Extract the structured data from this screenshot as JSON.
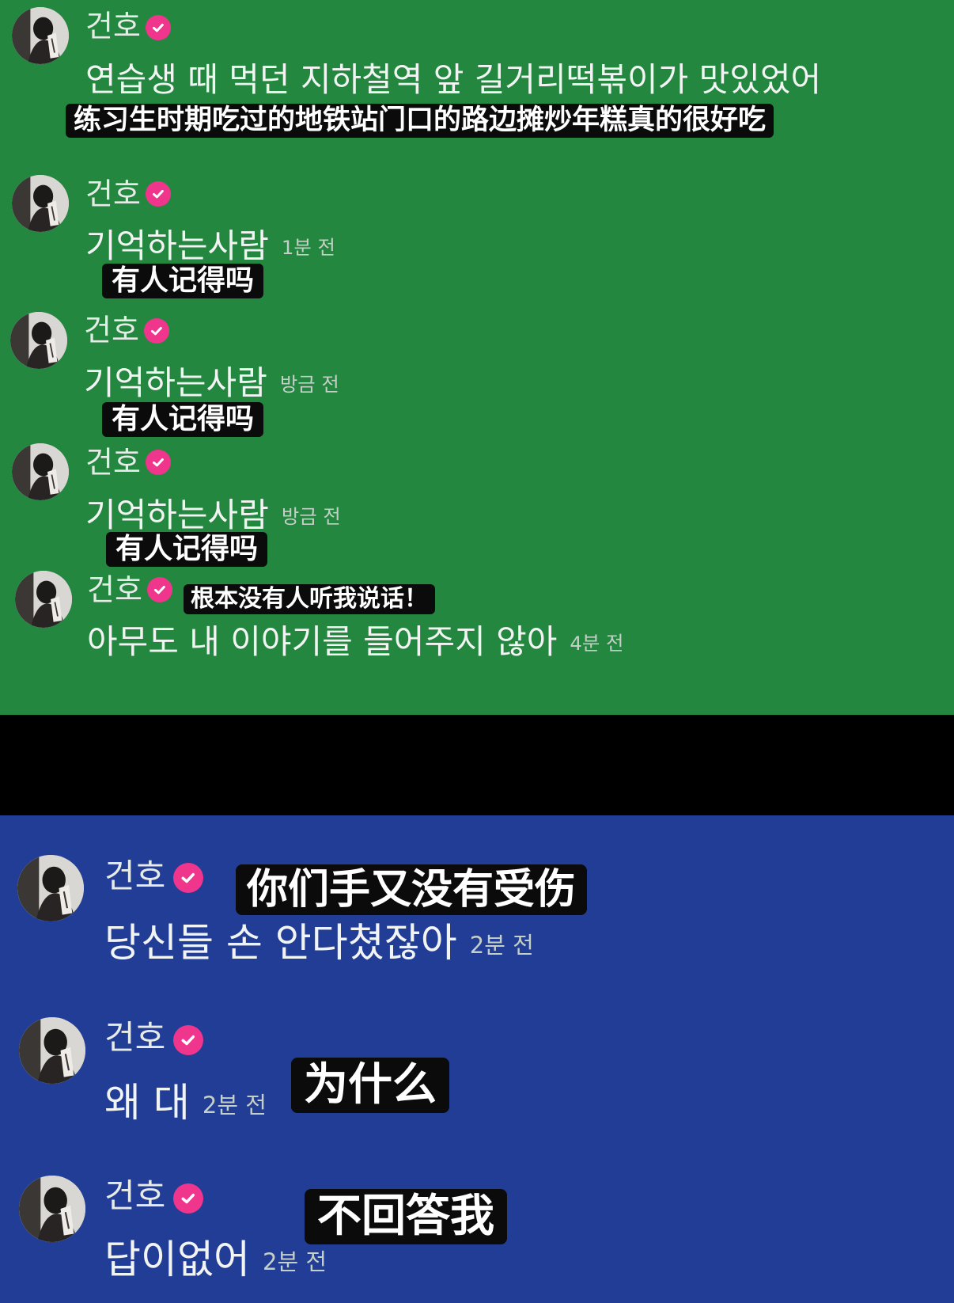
{
  "top_messages": [
    {
      "user": "건호",
      "text": "연습생 때 먹던 지하철역 앞 길거리떡볶이가 맛있었어",
      "time": "",
      "subtitle": "练习生时期吃过的地铁站门口的路边摊炒年糕真的很好吃"
    },
    {
      "user": "건호",
      "text": "기억하는사람",
      "time": "1분 전",
      "subtitle": "有人记得吗"
    },
    {
      "user": "건호",
      "text": "기억하는사람",
      "time": "방금 전",
      "subtitle": "有人记得吗"
    },
    {
      "user": "건호",
      "text": "기억하는사람",
      "time": "방금 전",
      "subtitle": "有人记得吗"
    },
    {
      "user": "건호",
      "text": "아무도 내 이야기를 들어주지 않아",
      "time": "4분 전",
      "subtitle": "根本没有人听我说话！"
    }
  ],
  "bottom_messages": [
    {
      "user": "건호",
      "text": "당신들 손 안다쳤잖아",
      "time": "2분 전",
      "subtitle": "你们手又没有受伤"
    },
    {
      "user": "건호",
      "text": "왜 대",
      "time": "2분 전",
      "subtitle": "为什么"
    },
    {
      "user": "건호",
      "text": "답이없어",
      "time": "2분 전",
      "subtitle": "不回答我"
    }
  ],
  "colors": {
    "top_background": "#23873f",
    "bottom_background": "#213d96",
    "divider": "#000000",
    "verified_badge": "#f0358d",
    "subtitle_box": "#0b0b0b"
  },
  "icons": {
    "verified": "verified-check-badge-icon",
    "avatar": "user-avatar"
  }
}
